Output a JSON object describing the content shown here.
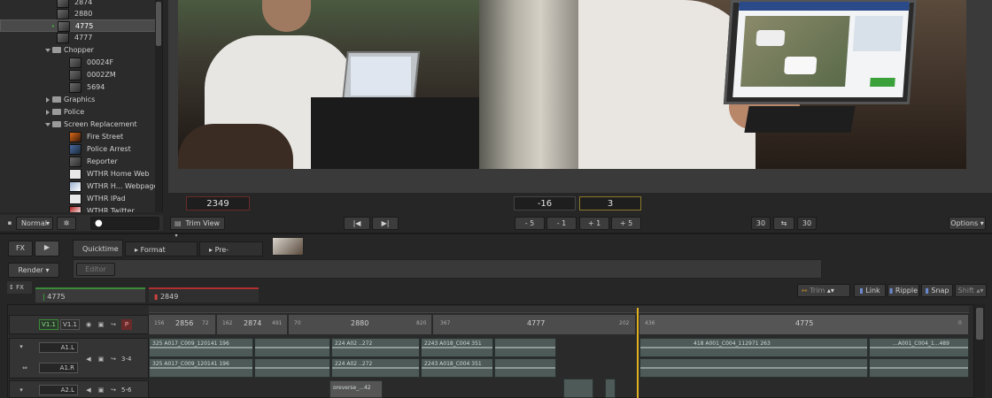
{
  "browser": {
    "items": [
      {
        "label": "2874",
        "kind": "clip"
      },
      {
        "label": "2880",
        "kind": "clip"
      },
      {
        "label": "4775",
        "kind": "clip",
        "selected": true
      },
      {
        "label": "4777",
        "kind": "clip"
      },
      {
        "label": "Chopper",
        "kind": "folder-open"
      },
      {
        "label": "00024F",
        "kind": "clip"
      },
      {
        "label": "0002ZM",
        "kind": "clip"
      },
      {
        "label": "5694",
        "kind": "clip"
      },
      {
        "label": "Graphics",
        "kind": "folder"
      },
      {
        "label": "Police",
        "kind": "folder"
      },
      {
        "label": "Screen Replacement",
        "kind": "folder-open"
      },
      {
        "label": "Fire Street",
        "kind": "clip"
      },
      {
        "label": "Police Arrest",
        "kind": "clip"
      },
      {
        "label": "Reporter",
        "kind": "clip"
      },
      {
        "label": "WTHR Home Web",
        "kind": "clip"
      },
      {
        "label": "WTHR H... Webpage",
        "kind": "clip"
      },
      {
        "label": "WTHR IPad",
        "kind": "clip"
      },
      {
        "label": "WTHR Twitter",
        "kind": "clip"
      }
    ],
    "blend_mode": "Normal"
  },
  "viewer": {
    "left_timecode": "2349",
    "offset_left": "-16",
    "offset_right": "3",
    "trim_view_label": "Trim View",
    "nudge": [
      "- 5",
      "- 1",
      "+ 1",
      "+ 5"
    ],
    "fps_left": "30",
    "fps_right": "30",
    "options_label": "Options"
  },
  "fx": {
    "fx_label": "FX",
    "render_label": "Render",
    "tabs": [
      "Quicktime",
      "Format Options",
      "Pre-Processing"
    ],
    "editor_label": "Editor",
    "fx_toggle": "FX"
  },
  "timeline": {
    "tabs": [
      {
        "label": "4775",
        "color": "#3a8a3a"
      },
      {
        "label": "2849",
        "color": "#b03030"
      }
    ],
    "tools": {
      "trim": "Trim",
      "link": "Link",
      "ripple": "Ripple",
      "snap": "Snap",
      "shift": "Shift"
    },
    "tracks": [
      {
        "name": "V1.1",
        "alt": "V1.1",
        "p": "P"
      },
      {
        "name": "A1.L",
        "routing": "3-4"
      },
      {
        "name": "A1.R"
      },
      {
        "name": "A2.L",
        "routing": "5-6"
      }
    ],
    "video_segments": [
      {
        "in": "156",
        "label": "2856",
        "out": "72"
      },
      {
        "in": "162",
        "label": "2874",
        "out": "491"
      },
      {
        "in": "70",
        "label": "2880",
        "out": "820"
      },
      {
        "in": "367",
        "label": "4777",
        "out": "202"
      },
      {
        "in": "436",
        "label": "4775",
        "out": "0"
      }
    ],
    "audio_clips": [
      {
        "label": "325 A017_C009_120141 196"
      },
      {
        "label": "224 A02 ..272"
      },
      {
        "label": "2243 A018_C004 351"
      },
      {
        "label": "418 A001_C004_112971 263"
      },
      {
        "label": "...A001_C004_1...489"
      },
      {
        "label": "325 A017_C009_120141 196"
      },
      {
        "label": "224 A02 ..272"
      },
      {
        "label": "2243 A018_C004 351"
      }
    ],
    "reverse_label": "oreverse_...42"
  }
}
